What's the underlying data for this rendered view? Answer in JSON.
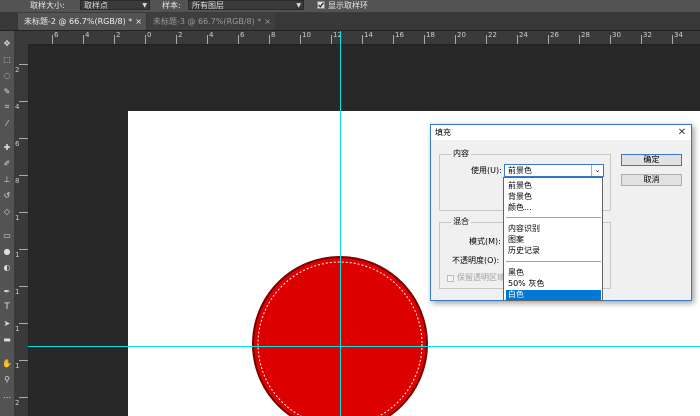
{
  "options_bar": {
    "sample_size_label": "取样大小:",
    "sample_size_value": "取样点",
    "sample_label": "样本:",
    "sample_value": "所有图层",
    "show_ring_label": "显示取样环",
    "show_ring_checked": true
  },
  "tabs": [
    {
      "label": "未标题-2 @ 66.7%(RGB/8) *",
      "active": true
    },
    {
      "label": "未标题-3 @ 66.7%(RGB/8) *",
      "active": false
    }
  ],
  "ruler": {
    "h_ticks": [
      "6",
      "4",
      "2",
      "0",
      "2",
      "4",
      "6",
      "8",
      "10",
      "12",
      "14",
      "16",
      "18",
      "20",
      "22",
      "24",
      "26",
      "28",
      "30",
      "32",
      "34"
    ],
    "v_ticks": [
      "2",
      "4",
      "6",
      "8",
      "1",
      "1",
      "1",
      "1",
      "1",
      "2"
    ]
  },
  "colors": {
    "circle_fill": "#dd0000",
    "guide": "#00e5e5",
    "selection_highlight": "#0078d7"
  },
  "dialog": {
    "title": "填充",
    "content_group": "内容",
    "use_label": "使用(U):",
    "use_value": "前景色",
    "blend_group": "混合",
    "mode_label": "模式(M):",
    "opacity_label": "不透明度(O):",
    "preserve_label": "保留透明区域",
    "ok": "确定",
    "cancel": "取消"
  },
  "dropdown_items": [
    "前景色",
    "背景色",
    "颜色...",
    "内容识别",
    "图案",
    "历史记录",
    "黑色",
    "50% 灰色",
    "白色"
  ],
  "dropdown_selected": "白色"
}
